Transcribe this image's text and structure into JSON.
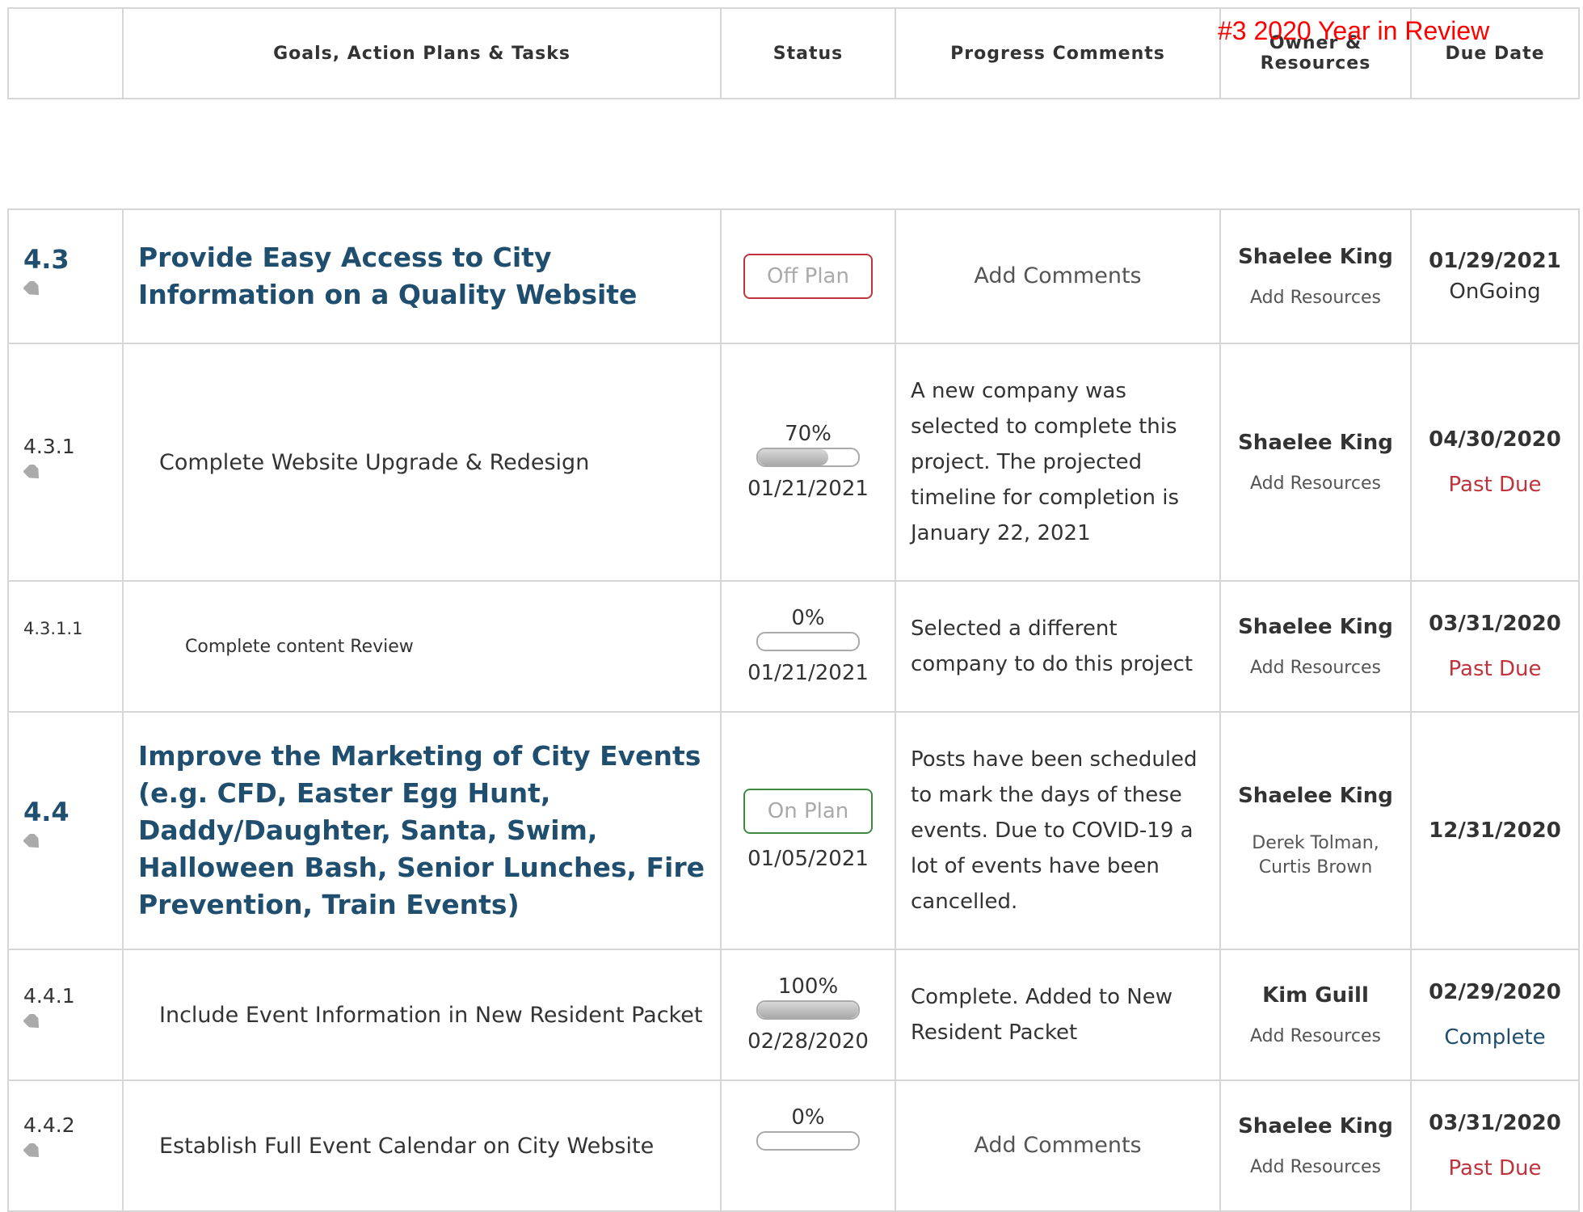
{
  "overlay_title": "#3 2020 Year in Review",
  "header": {
    "col_goals": "Goals, Action Plans & Tasks",
    "col_status": "Status",
    "col_comments": "Progress Comments",
    "col_owner_l1": "Owner &",
    "col_owner_l2": "Resources",
    "col_due": "Due Date"
  },
  "colors": {
    "goal_text": "#1f4e6e",
    "off_plan": "#c0333c",
    "on_plan": "#3e8a3e",
    "past_due": "#c0333c",
    "complete": "#1f4e6e"
  },
  "rows": [
    {
      "num": "4.3",
      "title": "Provide Easy Access to City Information on a Quality Website",
      "status_label": "Off Plan",
      "comment": "Add Comments",
      "owner": "Shaelee King",
      "resources": "Add Resources",
      "due_date": "01/29/2021",
      "due_status": "OnGoing",
      "icon": "tag-icon"
    },
    {
      "num": "4.3.1",
      "title": "Complete Website Upgrade & Redesign",
      "progress": "70%",
      "progress_fraction": 0.7,
      "status_date": "01/21/2021",
      "comment": " A new company was selected to complete this project. The projected timeline for completion is January 22, 2021",
      "owner": "Shaelee King",
      "resources": "Add Resources",
      "due_date": "04/30/2020",
      "due_status": "Past Due",
      "icon": "tag-icon"
    },
    {
      "num": "4.3.1.1",
      "title": "Complete content Review",
      "progress": "0%",
      "progress_fraction": 0,
      "status_date": "01/21/2021",
      "comment": "Selected a different company to do this project",
      "owner": "Shaelee King",
      "resources": "Add Resources",
      "due_date": "03/31/2020",
      "due_status": "Past Due"
    },
    {
      "num": "4.4",
      "title": "Improve the Marketing of City Events (e.g. CFD, Easter Egg Hunt, Daddy/Daughter, Santa, Swim, Halloween Bash, Senior Lunches, Fire Prevention, Train Events)",
      "status_label": "On Plan",
      "status_date": "01/05/2021",
      "comment": "Posts have been scheduled to mark the days of these events. Due to COVID-19 a lot of events have been cancelled.",
      "owner": "Shaelee King",
      "resources": "Derek Tolman, Curtis Brown",
      "due_date": "12/31/2020",
      "icon": "tag-icon"
    },
    {
      "num": "4.4.1",
      "title": "Include Event Information in New Resident Packet",
      "progress": "100%",
      "progress_fraction": 1.0,
      "status_date": "02/28/2020",
      "comment": "Complete. Added to New Resident Packet",
      "owner": "Kim Guill",
      "resources": "Add Resources",
      "due_date": "02/29/2020",
      "due_status": "Complete",
      "icon": "tag-icon"
    },
    {
      "num": "4.4.2",
      "title": "Establish Full Event Calendar on City Website",
      "progress": "0%",
      "progress_fraction": 0,
      "comment": "Add Comments",
      "owner": "Shaelee King",
      "resources": "Add Resources",
      "due_date": "03/31/2020",
      "due_status": "Past Due",
      "icon": "tag-icon"
    }
  ]
}
